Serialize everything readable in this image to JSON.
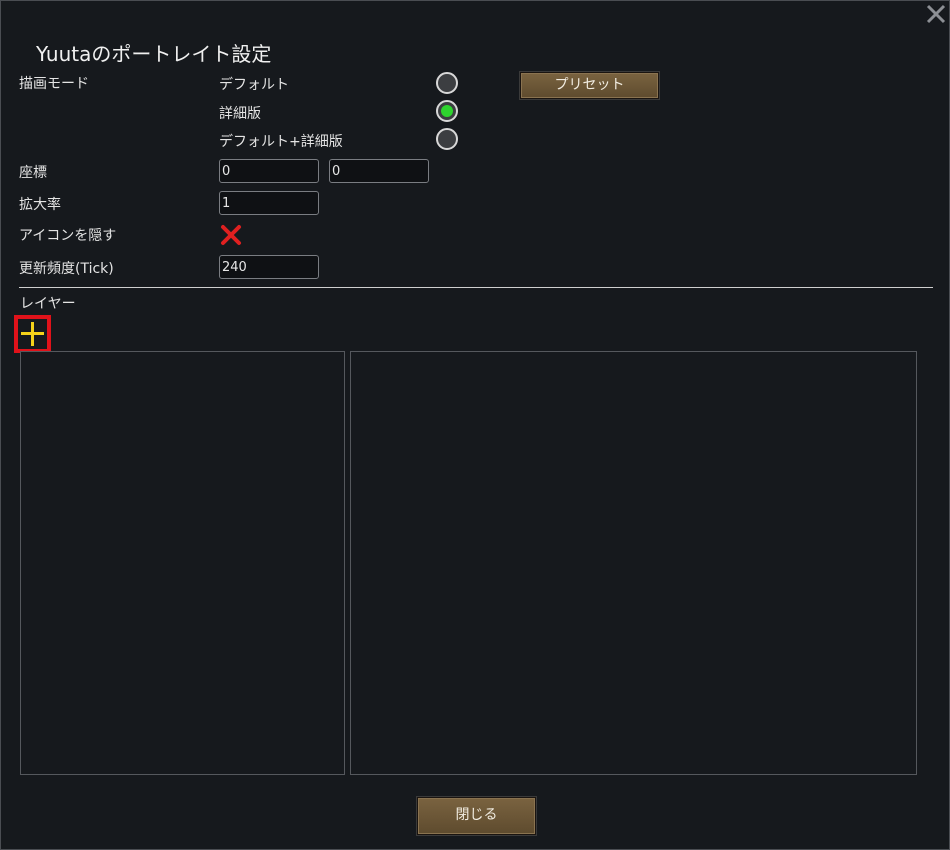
{
  "dialog": {
    "title": "Yuutaのポートレイト設定",
    "close_icon": "close-x-icon"
  },
  "render_mode": {
    "label": "描画モード",
    "options": [
      {
        "label": "デフォルト",
        "selected": false
      },
      {
        "label": "詳細版",
        "selected": true
      },
      {
        "label": "デフォルト+詳細版",
        "selected": false
      }
    ],
    "preset_button": "プリセット"
  },
  "coordinates": {
    "label": "座標",
    "x": "0",
    "y": "0"
  },
  "scale": {
    "label": "拡大率",
    "value": "1"
  },
  "hide_icon": {
    "label": "アイコンを隠す",
    "checked": false,
    "icon": "red-x-icon"
  },
  "update_frequency": {
    "label": "更新頻度(Tick)",
    "value": "240"
  },
  "layers": {
    "label": "レイヤー",
    "add_icon": "plus-icon"
  },
  "footer": {
    "close_button": "閉じる"
  },
  "colors": {
    "background": "#16191d",
    "button": "#6a5535",
    "radio_selected": "#2ed42e",
    "add_highlight": "#e0121a",
    "plus_icon": "#f5d21a",
    "unchecked_x": "#e02020"
  }
}
